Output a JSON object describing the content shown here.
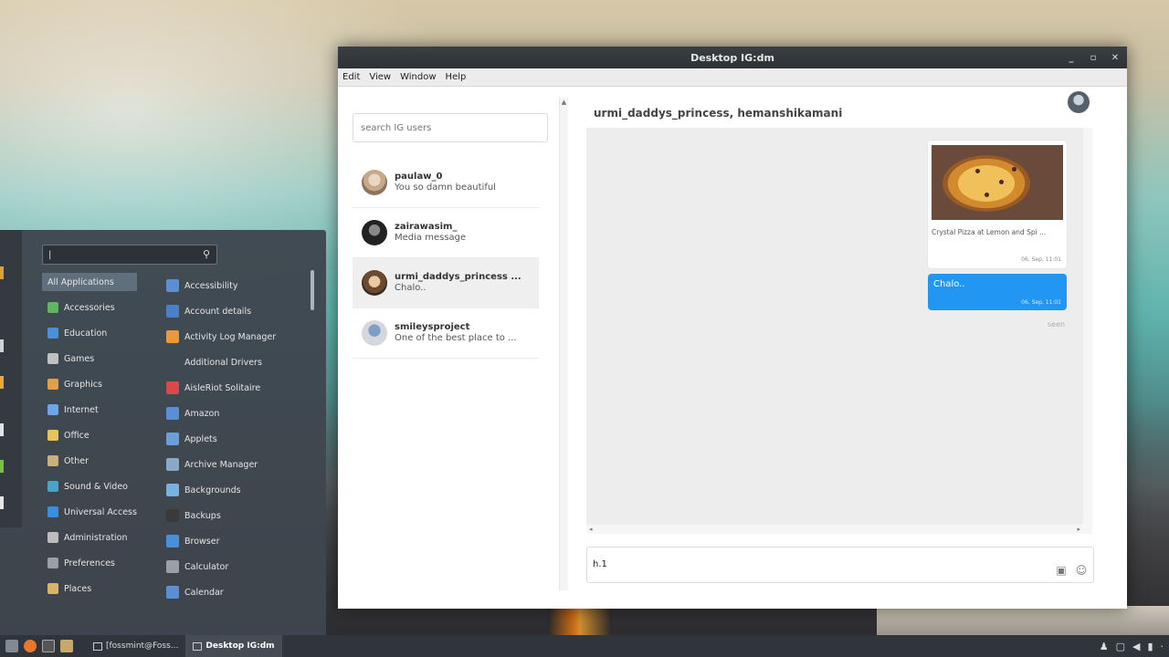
{
  "window": {
    "title": "Desktop IG:dm",
    "controls": [
      "_",
      "▫",
      "✕"
    ]
  },
  "menubar": [
    "Edit",
    "View",
    "Window",
    "Help"
  ],
  "sidebar": {
    "search_placeholder": "search IG users",
    "threads": [
      {
        "name": "paulaw_0",
        "preview": "You so damn beautiful",
        "avatar": "user-avatar-icon"
      },
      {
        "name": "zairawasim_",
        "preview": "Media message",
        "avatar": "user-avatar-icon"
      },
      {
        "name": "urmi_daddys_princess ...",
        "preview": "Chalo..",
        "avatar": "user-avatar-icon",
        "active": true
      },
      {
        "name": "smileysproject",
        "preview": "One of the best place to ...",
        "avatar": "user-avatar-icon"
      }
    ]
  },
  "chat": {
    "header": "urmi_daddys_princess, hemanshikamani",
    "media_card": {
      "caption": "Crystal Pizza at Lemon and Spi ...",
      "time": "06, Sep, 11:01"
    },
    "message": {
      "text": "Chalo..",
      "time": "06, Sep, 11:01"
    },
    "seen": "seen",
    "compose_value": "h.1"
  },
  "start_menu": {
    "search_value": "|",
    "categories": [
      {
        "label": "All Applications",
        "selected": true,
        "color": "#000000"
      },
      {
        "label": "Accessories",
        "color": "#5fb65f"
      },
      {
        "label": "Education",
        "color": "#4a90d9"
      },
      {
        "label": "Games",
        "color": "#c0c0c0"
      },
      {
        "label": "Graphics",
        "color": "#e0a04a"
      },
      {
        "label": "Internet",
        "color": "#6aa6e8"
      },
      {
        "label": "Office",
        "color": "#e8c35a"
      },
      {
        "label": "Other",
        "color": "#c9b178"
      },
      {
        "label": "Sound & Video",
        "color": "#4aa3c9"
      },
      {
        "label": "Universal Access",
        "color": "#3c8ee0"
      },
      {
        "label": "Administration",
        "color": "#bdbdbd"
      },
      {
        "label": "Preferences",
        "color": "#9aa0a6"
      },
      {
        "label": "Places",
        "color": "#d9b36a"
      }
    ],
    "apps": [
      {
        "label": "Accessibility",
        "color": "#5a8fd6"
      },
      {
        "label": "Account details",
        "color": "#4a7fc9"
      },
      {
        "label": "Activity Log Manager",
        "color": "#e89a3a"
      },
      {
        "label": "Additional Drivers",
        "color": ""
      },
      {
        "label": "AisleRiot Solitaire",
        "color": "#d64a4a"
      },
      {
        "label": "Amazon",
        "color": "#5a8fd6"
      },
      {
        "label": "Applets",
        "color": "#6a9fd8"
      },
      {
        "label": "Archive Manager",
        "color": "#8aa9c9"
      },
      {
        "label": "Backgrounds",
        "color": "#7ab0e0"
      },
      {
        "label": "Backups",
        "color": "#3a3a3a"
      },
      {
        "label": "Browser",
        "color": "#4a90d9"
      },
      {
        "label": "Calculator",
        "color": "#9aa0a6"
      },
      {
        "label": "Calendar",
        "color": "#5a8fd6"
      }
    ]
  },
  "taskbar": {
    "tasks": [
      {
        "label": "[fossmint@Foss...",
        "active": false
      },
      {
        "label": "Desktop IG:dm",
        "active": true
      }
    ],
    "tray": [
      "user-icon",
      "window-list-icon",
      "volume-icon",
      "battery-icon",
      "clock-icon"
    ]
  },
  "colors": {
    "accent": "#2196f3",
    "menu_bg": "#3e464e",
    "taskbar_bg": "#2f353a"
  }
}
